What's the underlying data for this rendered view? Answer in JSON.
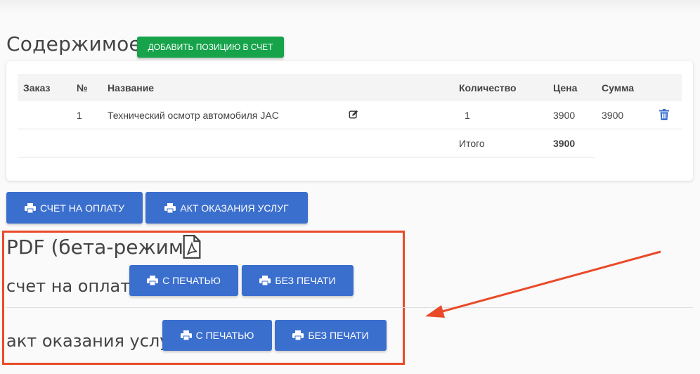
{
  "contents": {
    "title": "Содержимое",
    "add_button": "Добавить позицию в счет"
  },
  "table": {
    "headers": {
      "order": "Заказ",
      "num": "№",
      "name": "Название",
      "qty": "Количество",
      "price": "Цена",
      "sum": "Сумма"
    },
    "rows": [
      {
        "num": "1",
        "name": "Технический осмотр автомобиля JAC",
        "qty": "1",
        "price": "3900",
        "sum": "3900"
      }
    ],
    "total_label": "Итого",
    "total_value": "3900"
  },
  "actions": {
    "invoice_button": "Счет на оплату",
    "act_button": "Акт оказания услуг"
  },
  "pdf": {
    "title": "PDF (бета-режим)",
    "invoice_label": "счет на оплату",
    "act_label": "акт оказания услуг",
    "with_stamp": "С печатью",
    "without_stamp": "Без печати"
  },
  "colors": {
    "green": "#16a34a",
    "blue": "#3b6fce",
    "highlight": "#ea4a2a"
  }
}
